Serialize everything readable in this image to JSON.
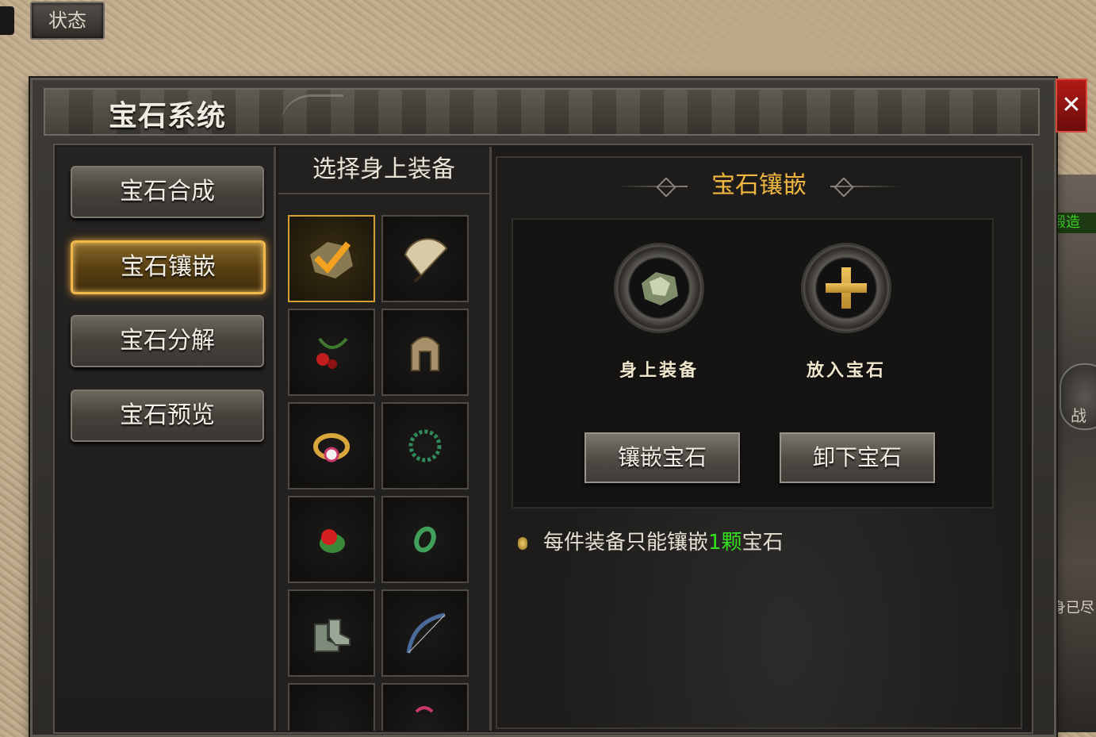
{
  "status_button": {
    "label": "状态"
  },
  "window": {
    "title": "宝石系统",
    "close_label": "✕"
  },
  "nav": {
    "items": [
      {
        "label": "宝石合成",
        "active": false
      },
      {
        "label": "宝石镶嵌",
        "active": true
      },
      {
        "label": "宝石分解",
        "active": false
      },
      {
        "label": "宝石预览",
        "active": false
      }
    ]
  },
  "equipment": {
    "header": "选择身上装备",
    "slots": [
      {
        "icon": "armor-checked-icon",
        "selected": true
      },
      {
        "icon": "fan-icon",
        "selected": false
      },
      {
        "icon": "berry-necklace-icon",
        "selected": false
      },
      {
        "icon": "helmet-icon",
        "selected": false
      },
      {
        "icon": "ring-icon",
        "selected": false
      },
      {
        "icon": "bead-bracelet-icon",
        "selected": false
      },
      {
        "icon": "ruby-ring-icon",
        "selected": false
      },
      {
        "icon": "jade-ring-icon",
        "selected": false
      },
      {
        "icon": "boots-icon",
        "selected": false
      },
      {
        "icon": "bow-icon",
        "selected": false
      },
      {
        "icon": "item-icon",
        "selected": false
      },
      {
        "icon": "item-icon",
        "selected": false
      }
    ]
  },
  "inlay": {
    "title": "宝石镶嵌",
    "equip_socket_label": "身上装备",
    "gem_socket_label": "放入宝石",
    "inlay_button": "镶嵌宝石",
    "remove_button": "卸下宝石",
    "note_prefix": "每件装备只能镶嵌",
    "note_highlight": "1颗",
    "note_suffix": "宝石"
  },
  "side": {
    "tag": "锻造",
    "round_label": "战",
    "bottom_text": "身已尽"
  },
  "colors": {
    "accent": "#f0b640",
    "highlight": "#34e01d",
    "close": "#b21a16"
  }
}
